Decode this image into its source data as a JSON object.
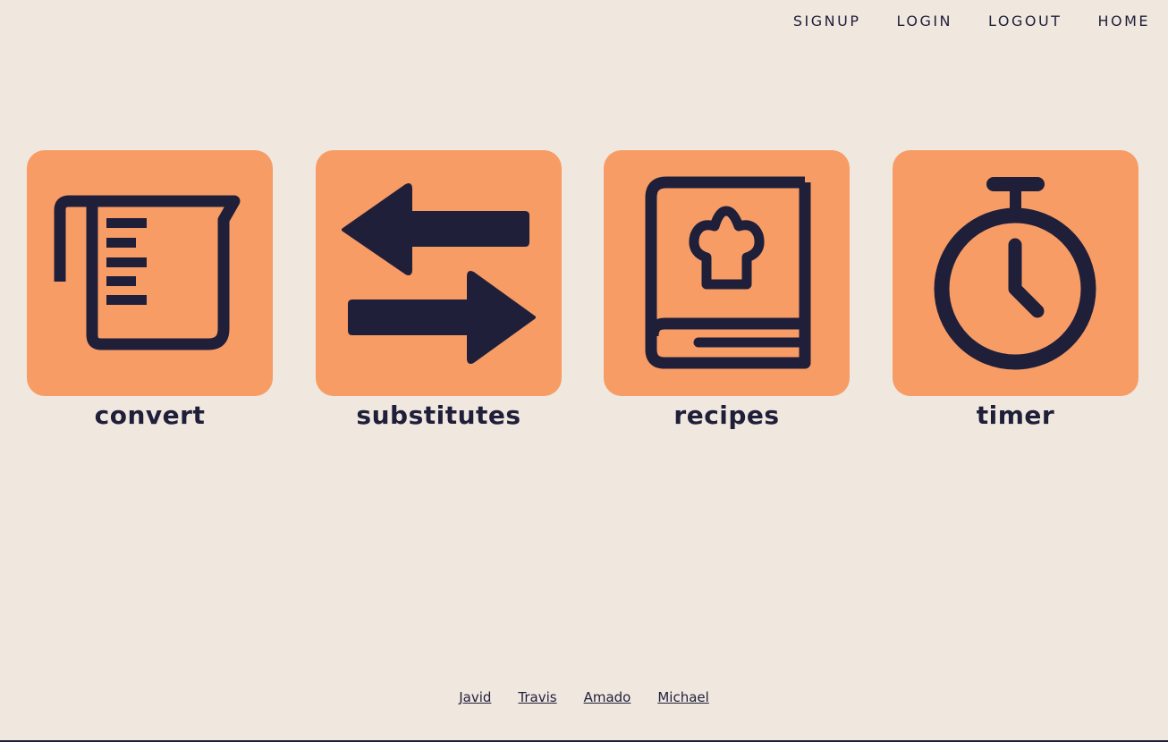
{
  "nav": {
    "items": [
      {
        "label": "SIGNUP"
      },
      {
        "label": "LOGIN"
      },
      {
        "label": "LOGOUT"
      },
      {
        "label": "HOME"
      }
    ]
  },
  "tiles": [
    {
      "label": "convert",
      "icon": "measuring-cup-icon"
    },
    {
      "label": "substitutes",
      "icon": "swap-arrows-icon"
    },
    {
      "label": "recipes",
      "icon": "recipe-book-icon"
    },
    {
      "label": "timer",
      "icon": "stopwatch-icon"
    }
  ],
  "footer": {
    "links": [
      {
        "label": "Javid"
      },
      {
        "label": "Travis"
      },
      {
        "label": "Amado"
      },
      {
        "label": "Michael"
      }
    ]
  },
  "colors": {
    "background": "#f0e7df",
    "tile": "#f89c66",
    "ink": "#1f1f3a"
  }
}
